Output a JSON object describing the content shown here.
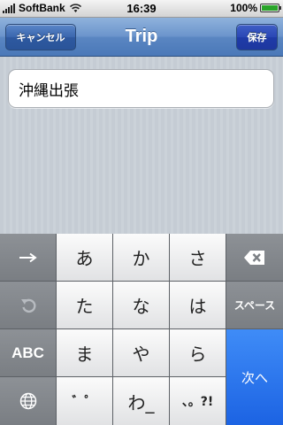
{
  "status_bar": {
    "carrier": "SoftBank",
    "time": "16:39",
    "battery": "100%",
    "battery_level": 1.0
  },
  "nav": {
    "title": "Trip",
    "cancel_label": "キャンセル",
    "save_label": "保存"
  },
  "field": {
    "value": "沖縄出張"
  },
  "keyboard": {
    "rows": [
      [
        "あ",
        "か",
        "さ"
      ],
      [
        "た",
        "な",
        "は"
      ],
      [
        "ま",
        "や",
        "ら"
      ],
      [
        "゛゜",
        "わ_",
        "、。?!"
      ]
    ],
    "abc_label": "ABC",
    "space_label": "スペース",
    "next_label": "次へ"
  }
}
